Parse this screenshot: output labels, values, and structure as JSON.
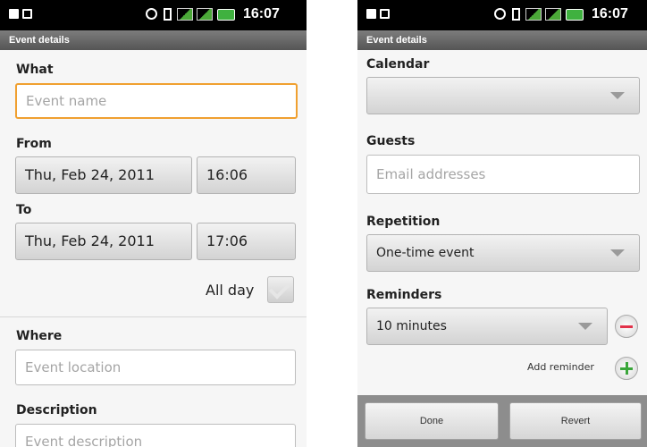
{
  "left": {
    "status": {
      "time": "16:07"
    },
    "title": "Event details",
    "what_label": "What",
    "event_name_placeholder": "Event name",
    "from_label": "From",
    "from_date": "Thu, Feb 24, 2011",
    "from_time": "16:06",
    "to_label": "To",
    "to_date": "Thu, Feb 24, 2011",
    "to_time": "17:06",
    "allday_label": "All day",
    "where_label": "Where",
    "location_placeholder": "Event location",
    "description_label": "Description",
    "description_placeholder": "Event description"
  },
  "right": {
    "status": {
      "time": "16:07"
    },
    "title": "Event details",
    "calendar_label": "Calendar",
    "calendar_value": "",
    "guests_label": "Guests",
    "guests_placeholder": "Email addresses",
    "repetition_label": "Repetition",
    "repetition_value": "One-time event",
    "reminders_label": "Reminders",
    "reminder_value": "10 minutes",
    "add_reminder_label": "Add reminder",
    "done_label": "Done",
    "revert_label": "Revert"
  },
  "icons": {
    "remove": "minus-circle-icon",
    "add": "plus-circle-icon",
    "dropdown": "chevron-down-icon"
  },
  "colors": {
    "focus_border": "#f0a030",
    "remove_icon": "#e2324a",
    "add_icon": "#3aa63a"
  }
}
